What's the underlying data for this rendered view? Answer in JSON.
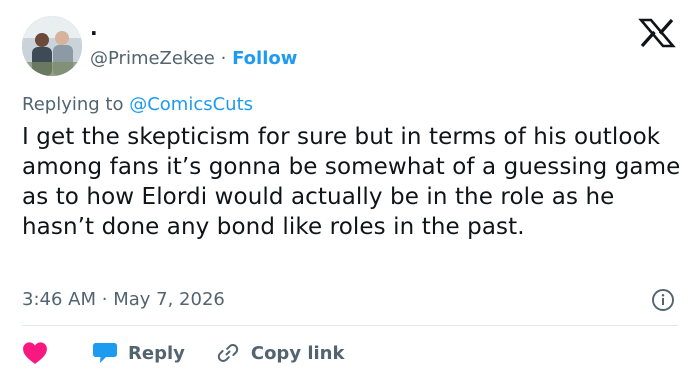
{
  "author": {
    "display_name": ".",
    "handle": "@PrimeZekee",
    "separator": "·",
    "follow_label": "Follow"
  },
  "reply_context": {
    "prefix": "Replying to",
    "handle": "@ComicsCuts"
  },
  "tweet": {
    "text": "I get the skepticism for sure but in terms of his outlook among fans it’s gonna be somewhat of a guessing game as to how Elordi would actually be in the role as he hasn’t done any bond like roles in the past."
  },
  "meta": {
    "time": "3:46 AM",
    "separator": "·",
    "date": "May 7, 2026"
  },
  "actions": {
    "reply_label": "Reply",
    "copy_link_label": "Copy link"
  },
  "icons": {
    "brand": "x-logo-icon",
    "info": "info-icon",
    "like": "heart-icon",
    "reply": "speech-bubble-icon",
    "copy": "link-icon"
  },
  "colors": {
    "accent": "#1d9bf0",
    "heart": "#f91880",
    "secondary_text": "#536471",
    "primary_text": "#0f1419"
  }
}
